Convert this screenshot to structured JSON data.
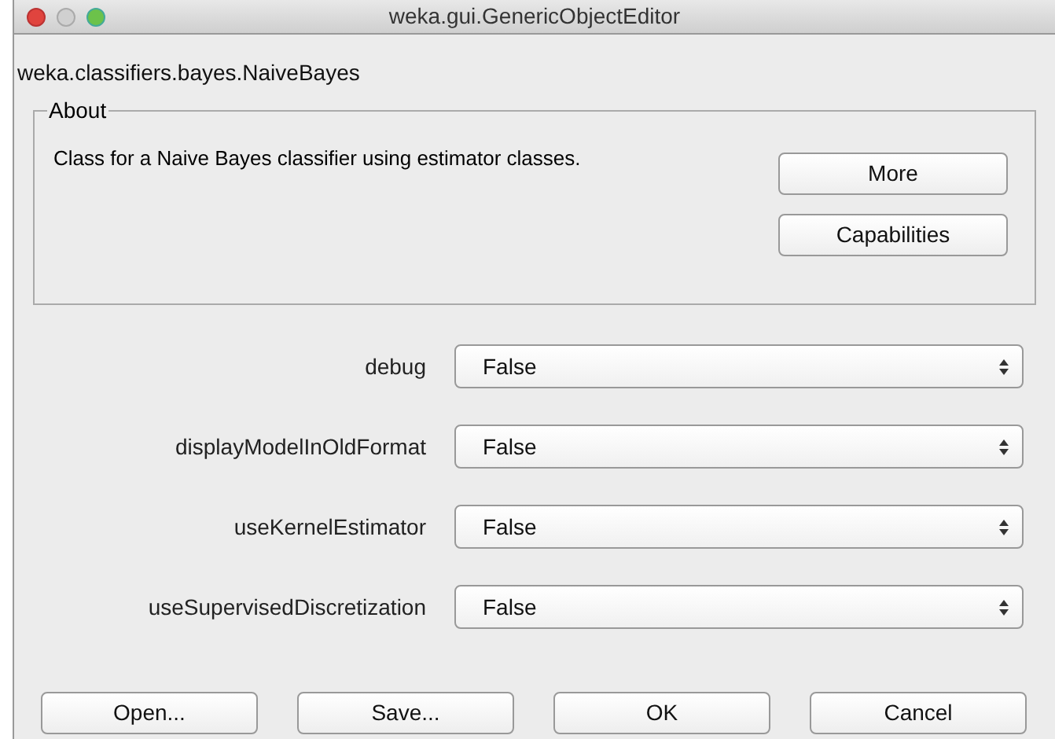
{
  "window": {
    "title": "weka.gui.GenericObjectEditor"
  },
  "class_name": "weka.classifiers.bayes.NaiveBayes",
  "about": {
    "title": "About",
    "description": "Class for a Naive Bayes classifier using estimator classes.",
    "buttons": [
      "More",
      "Capabilities"
    ]
  },
  "properties": [
    {
      "label": "debug",
      "value": "False"
    },
    {
      "label": "displayModelInOldFormat",
      "value": "False"
    },
    {
      "label": "useKernelEstimator",
      "value": "False"
    },
    {
      "label": "useSupervisedDiscretization",
      "value": "False"
    }
  ],
  "buttons": [
    "Open...",
    "Save...",
    "OK",
    "Cancel"
  ]
}
